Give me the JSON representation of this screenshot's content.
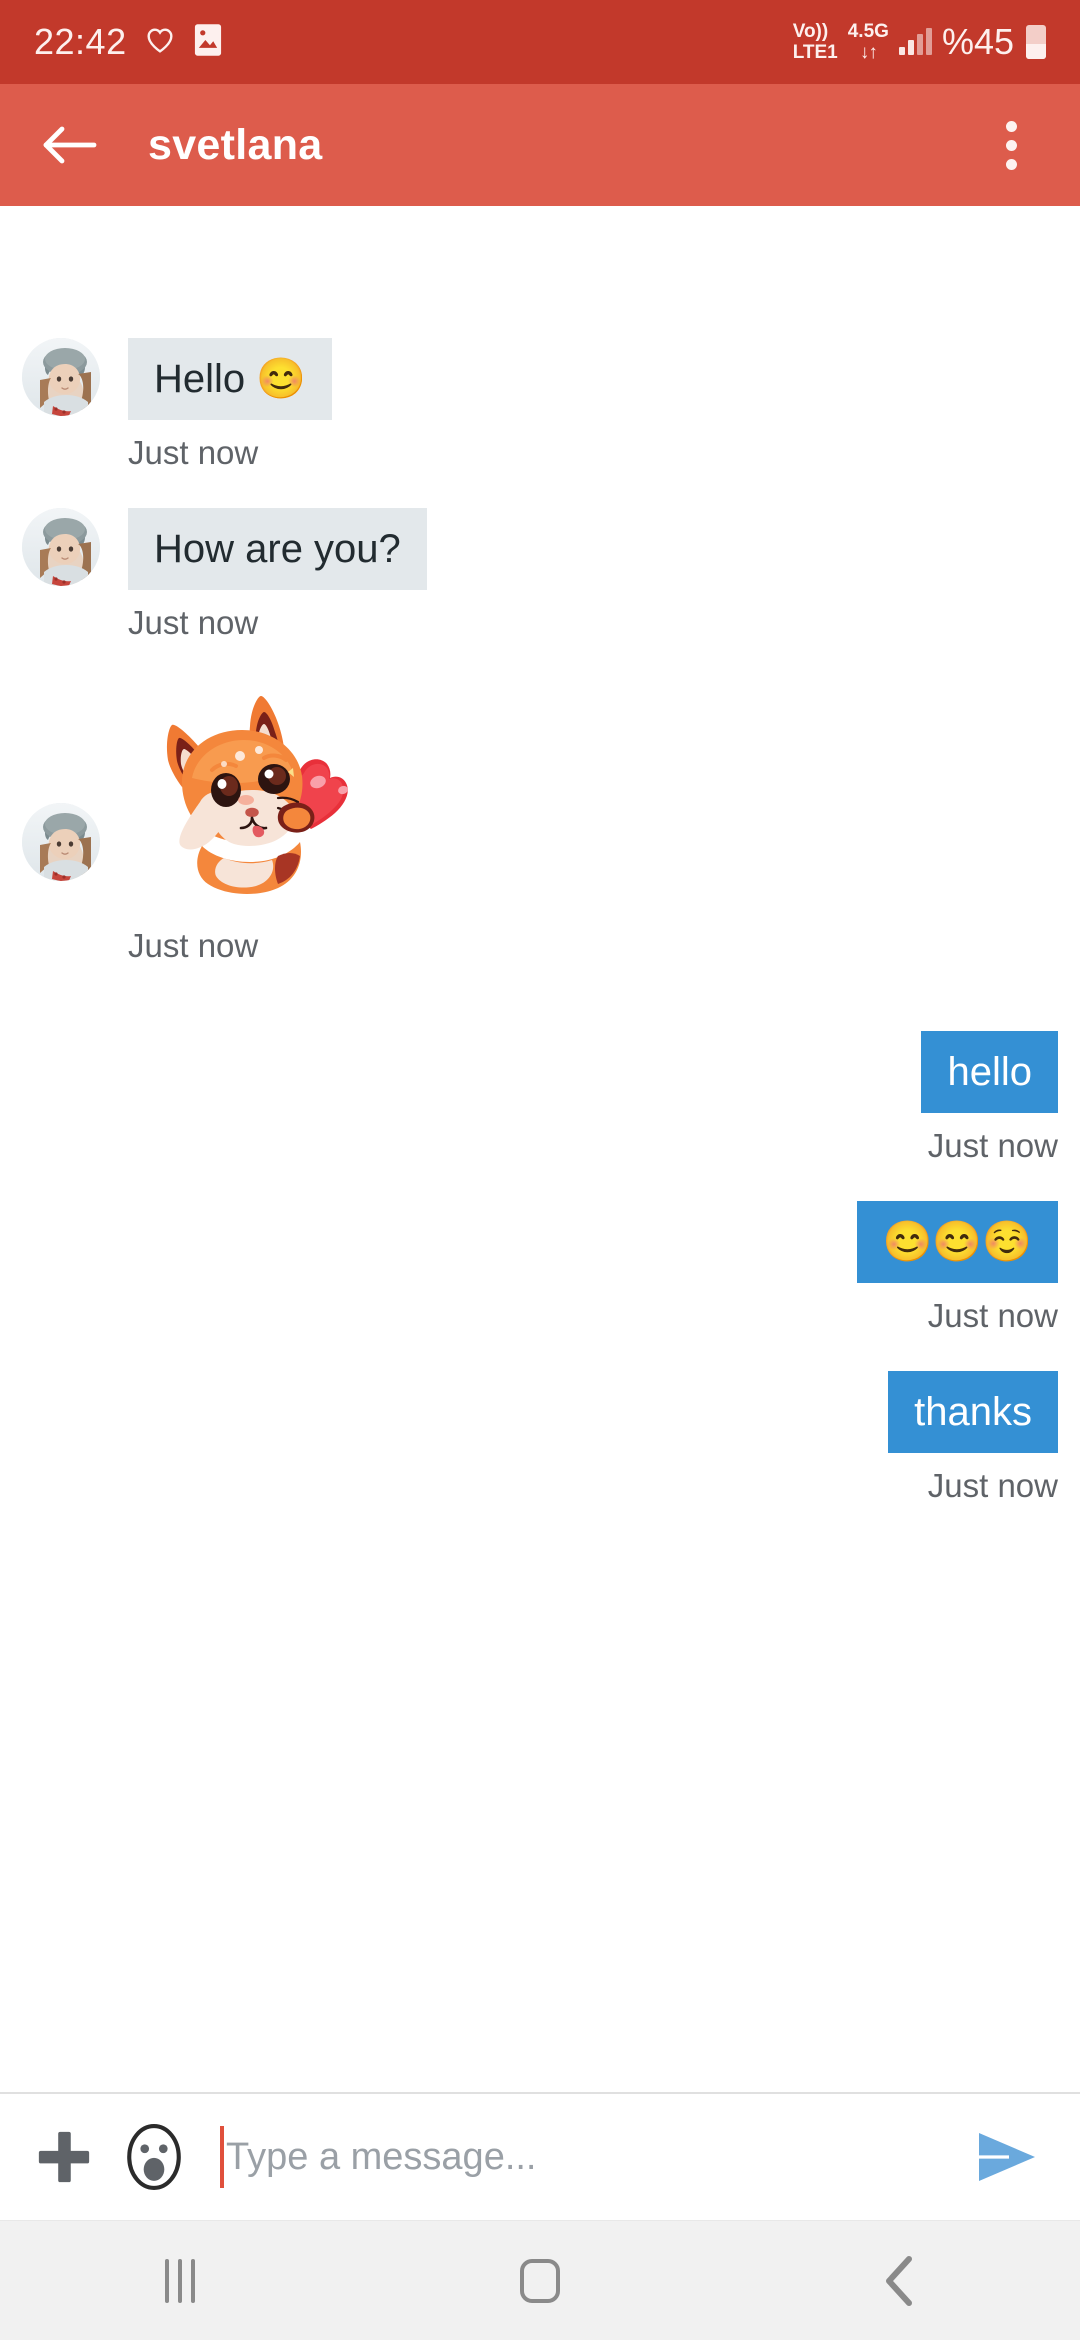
{
  "status_bar": {
    "clock": "22:42",
    "heart_icon": "heart-icon",
    "photo_icon": "photo-icon",
    "volte_top": "Vo))",
    "volte_bottom": "LTE1",
    "network_type": "4.5G",
    "network_arrows": "↓↑",
    "battery_percent": "%45",
    "background_color": "#c2392b"
  },
  "app_bar": {
    "title": "svetlana",
    "back_icon": "arrow-left-icon",
    "overflow_icon": "more-vertical-icon",
    "background_color": "#dd5c4c"
  },
  "chat": {
    "incoming_bubble_color": "#e3e8eb",
    "outgoing_bubble_color": "#3490d4",
    "messages": [
      {
        "id": "m1",
        "direction": "incoming",
        "type": "text",
        "text": "Hello 😊",
        "timestamp": "Just now",
        "avatar": "svetlana-avatar"
      },
      {
        "id": "m2",
        "direction": "incoming",
        "type": "text",
        "text": "How are you?",
        "timestamp": "Just now",
        "avatar": "svetlana-avatar"
      },
      {
        "id": "m3",
        "direction": "incoming",
        "type": "sticker",
        "sticker_name": "fox-with-heart-sticker",
        "timestamp": "Just now",
        "avatar": "svetlana-avatar"
      },
      {
        "id": "m4",
        "direction": "outgoing",
        "type": "text",
        "text": "hello",
        "timestamp": "Just now"
      },
      {
        "id": "m5",
        "direction": "outgoing",
        "type": "text",
        "text": "😊😊☺️",
        "timestamp": "Just now"
      },
      {
        "id": "m6",
        "direction": "outgoing",
        "type": "text",
        "text": "thanks",
        "timestamp": "Just now"
      }
    ]
  },
  "composer": {
    "attach_icon": "plus-icon",
    "emoji_icon": "emoji-face-icon",
    "placeholder": "Type a message...",
    "value": "",
    "send_icon": "send-icon",
    "cursor_color": "#e0503c",
    "send_color": "#6aa9dd"
  },
  "nav_bar": {
    "recents_icon": "recents-icon",
    "home_icon": "home-icon",
    "back_icon": "back-chevron-icon",
    "background_color": "#f1f1f1"
  }
}
